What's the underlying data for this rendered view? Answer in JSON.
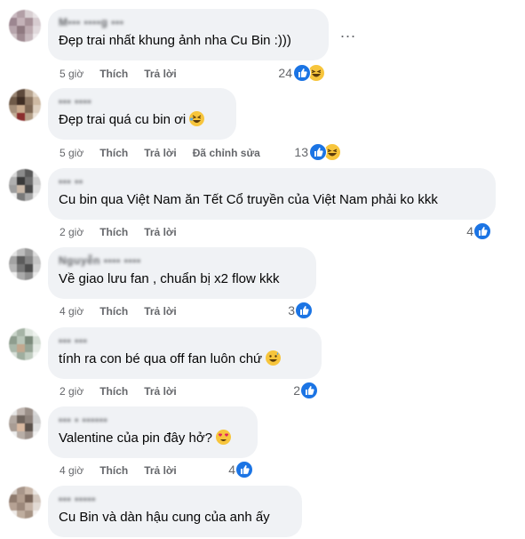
{
  "colors": {
    "bubble_bg": "#f0f2f5",
    "meta_text": "#65676b",
    "like_blue": "#1b74e4",
    "emoji_yellow": "#f7c53c"
  },
  "more_options": "...",
  "comments": [
    {
      "author": "M▪▪▪ ▪▪▪▪g ▪▪▪",
      "text": "Đẹp trai nhất khung ảnh nha Cu Bin :)))",
      "time": "5 giờ",
      "like": "Thích",
      "reply": "Trả lời",
      "edited": "",
      "reaction_count": "24",
      "reactions": [
        "like-icon",
        "haha-icon"
      ],
      "emoji": ""
    },
    {
      "author": "▪▪▪ ▪▪▪▪",
      "text": "Đẹp trai quá cu bin ơi",
      "time": "5 giờ",
      "like": "Thích",
      "reply": "Trả lời",
      "edited": "Đã chỉnh sửa",
      "reaction_count": "13",
      "reactions": [
        "like-icon",
        "haha-icon"
      ],
      "emoji": "rofl-emoji"
    },
    {
      "author": "▪▪▪ ▪▪",
      "text": "Cu bin qua Việt Nam ăn Tết Cổ truyền của Việt Nam phải ko kkk",
      "time": "2 giờ",
      "like": "Thích",
      "reply": "Trả lời",
      "edited": "",
      "reaction_count": "4",
      "reactions": [
        "like-icon"
      ],
      "emoji": ""
    },
    {
      "author": "Nguyễn ▪▪▪▪ ▪▪▪▪",
      "text": "Về giao lưu fan , chuẩn bị x2 flow kkk",
      "time": "4 giờ",
      "like": "Thích",
      "reply": "Trả lời",
      "edited": "",
      "reaction_count": "3",
      "reactions": [
        "like-icon"
      ],
      "emoji": ""
    },
    {
      "author": "▪▪▪ ▪▪▪",
      "text": "tính ra con bé qua off fan luôn chứ",
      "time": "2 giờ",
      "like": "Thích",
      "reply": "Trả lời",
      "edited": "",
      "reaction_count": "2",
      "reactions": [
        "like-icon"
      ],
      "emoji": "grin-sweat-emoji"
    },
    {
      "author": "▪▪▪ ▪ ▪▪▪▪▪▪",
      "text": "Valentine của pin đây hở?",
      "time": "4 giờ",
      "like": "Thích",
      "reply": "Trả lời",
      "edited": "",
      "reaction_count": "4",
      "reactions": [
        "like-icon"
      ],
      "emoji": "heart-eyes-emoji"
    },
    {
      "author": "▪▪▪ ▪▪▪▪▪",
      "text": "Cu Bin và dàn hậu cung của anh ấy",
      "time": "",
      "like": "",
      "reply": "",
      "edited": "",
      "reaction_count": "",
      "reactions": [],
      "emoji": ""
    }
  ]
}
